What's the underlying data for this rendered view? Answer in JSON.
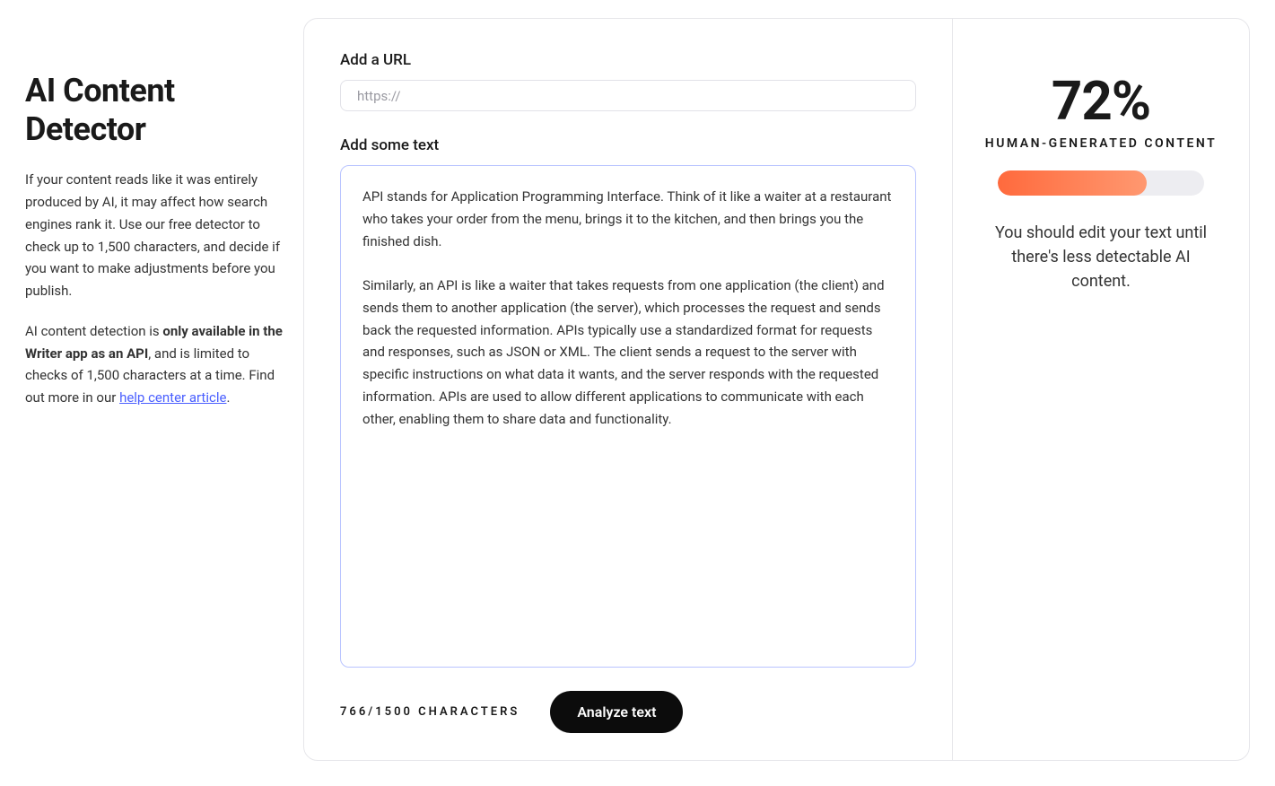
{
  "sidebar": {
    "title": "AI Content Detector",
    "para1": "If your content reads like it was entirely produced by AI, it may affect how search engines rank it. Use our free detector to check up to 1,500 characters, and decide if you want to make adjustments before you publish.",
    "para2_prefix": "AI content detection is ",
    "para2_bold": "only available in the Writer app as an API",
    "para2_suffix": ", and is limited to checks of 1,500 characters at a time. Find out more in our ",
    "link_text": "help center article",
    "para2_end": "."
  },
  "form": {
    "url_label": "Add a URL",
    "url_placeholder": "https://",
    "text_label": "Add some text",
    "text_value": "API stands for Application Programming Interface. Think of it like a waiter at a restaurant who takes your order from the menu, brings it to the kitchen, and then brings you the finished dish.\n\nSimilarly, an API is like a waiter that takes requests from one application (the client) and sends them to another application (the server), which processes the request and sends back the requested information. APIs typically use a standardized format for requests and responses, such as JSON or XML. The client sends a request to the server with specific instructions on what data it wants, and the server responds with the requested information. APIs are used to allow different applications to communicate with each other, enabling them to share data and functionality.",
    "char_count": "766/1500 CHARACTERS",
    "analyze_label": "Analyze text"
  },
  "result": {
    "percent": "72%",
    "label": "HUMAN-GENERATED CONTENT",
    "progress_width": "72%",
    "suggestion": "You should edit your text until there's less detectable AI content."
  }
}
